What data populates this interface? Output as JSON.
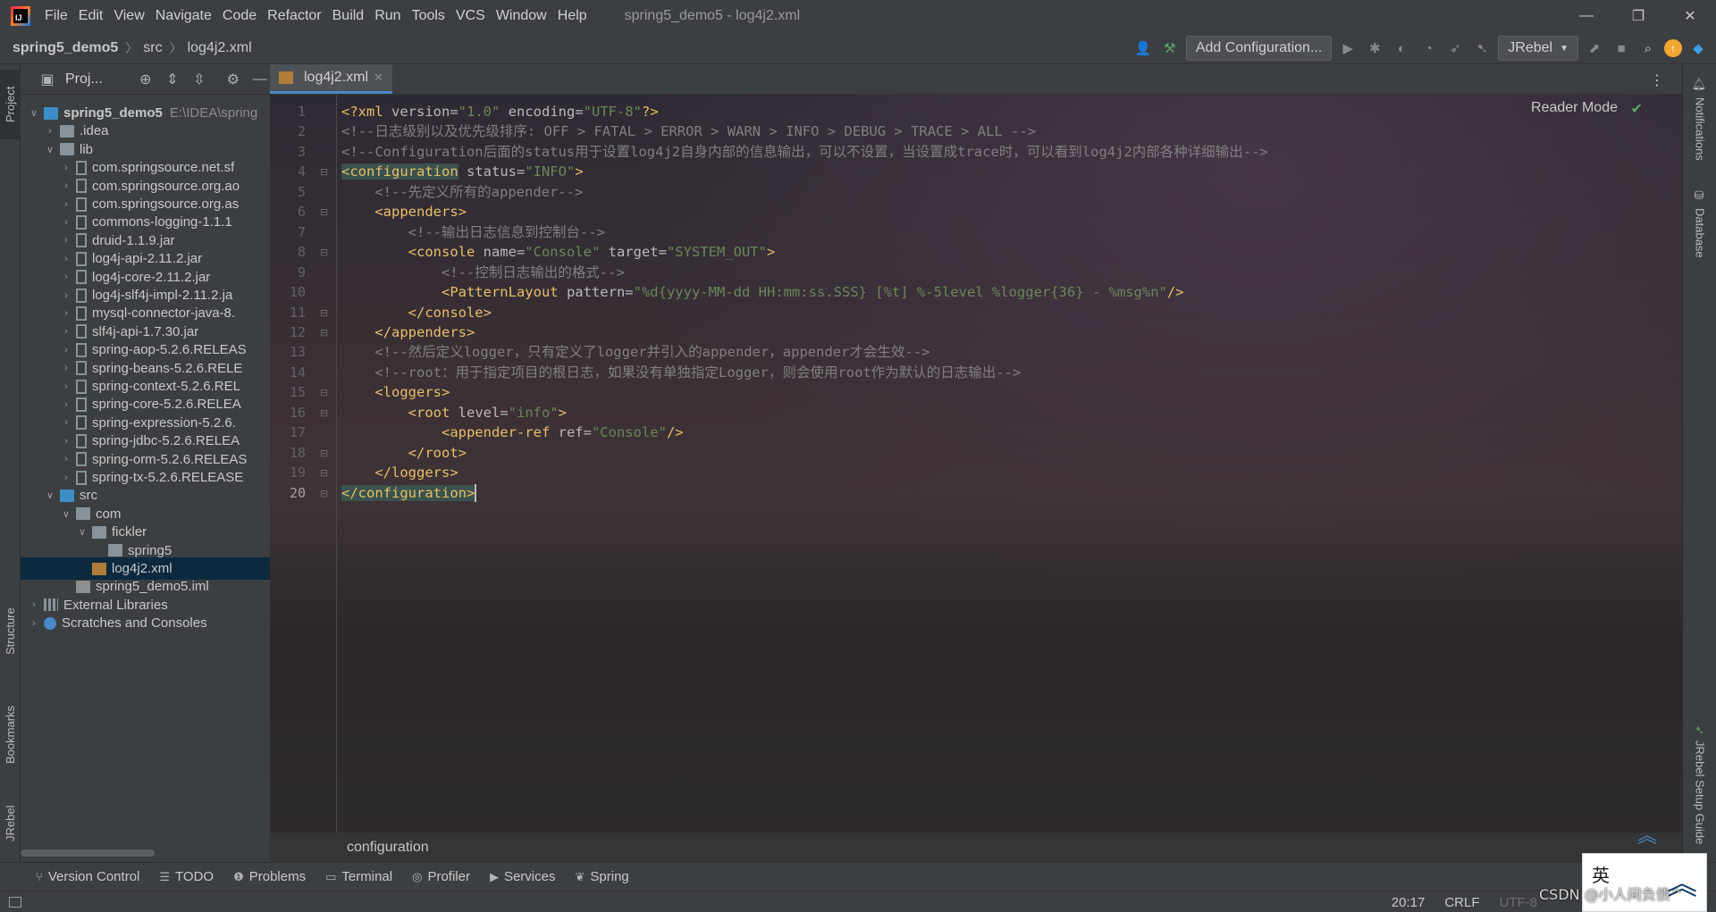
{
  "titlebar": {
    "menu": [
      "File",
      "Edit",
      "View",
      "Navigate",
      "Code",
      "Refactor",
      "Build",
      "Run",
      "Tools",
      "VCS",
      "Window",
      "Help"
    ],
    "window_title": "spring5_demo5 - log4j2.xml"
  },
  "navbar": {
    "breadcrumb": [
      "spring5_demo5",
      "src",
      "log4j2.xml"
    ],
    "add_configuration": "Add Configuration...",
    "jrebel_label": "JRebel"
  },
  "left_strip": {
    "project": "Project",
    "structure": "Structure",
    "bookmarks": "Bookmarks",
    "jrebel": "JRebel"
  },
  "project_panel": {
    "title": "Proj...",
    "tree": [
      {
        "label": "spring5_demo5",
        "path": "E:\\IDEA\\spring",
        "indent": 0,
        "arrow": "down",
        "icon": "module-folder",
        "bold": true
      },
      {
        "label": ".idea",
        "indent": 1,
        "arrow": "right",
        "icon": "folder"
      },
      {
        "label": "lib",
        "indent": 1,
        "arrow": "down",
        "icon": "folder"
      },
      {
        "label": "com.springsource.net.sf",
        "indent": 2,
        "arrow": "right",
        "icon": "jar"
      },
      {
        "label": "com.springsource.org.ao",
        "indent": 2,
        "arrow": "right",
        "icon": "jar"
      },
      {
        "label": "com.springsource.org.as",
        "indent": 2,
        "arrow": "right",
        "icon": "jar"
      },
      {
        "label": "commons-logging-1.1.1",
        "indent": 2,
        "arrow": "right",
        "icon": "jar"
      },
      {
        "label": "druid-1.1.9.jar",
        "indent": 2,
        "arrow": "right",
        "icon": "jar"
      },
      {
        "label": "log4j-api-2.11.2.jar",
        "indent": 2,
        "arrow": "right",
        "icon": "jar"
      },
      {
        "label": "log4j-core-2.11.2.jar",
        "indent": 2,
        "arrow": "right",
        "icon": "jar"
      },
      {
        "label": "log4j-slf4j-impl-2.11.2.ja",
        "indent": 2,
        "arrow": "right",
        "icon": "jar"
      },
      {
        "label": "mysql-connector-java-8.",
        "indent": 2,
        "arrow": "right",
        "icon": "jar"
      },
      {
        "label": "slf4j-api-1.7.30.jar",
        "indent": 2,
        "arrow": "right",
        "icon": "jar"
      },
      {
        "label": "spring-aop-5.2.6.RELEAS",
        "indent": 2,
        "arrow": "right",
        "icon": "jar"
      },
      {
        "label": "spring-beans-5.2.6.RELE",
        "indent": 2,
        "arrow": "right",
        "icon": "jar"
      },
      {
        "label": "spring-context-5.2.6.REL",
        "indent": 2,
        "arrow": "right",
        "icon": "jar"
      },
      {
        "label": "spring-core-5.2.6.RELEA",
        "indent": 2,
        "arrow": "right",
        "icon": "jar"
      },
      {
        "label": "spring-expression-5.2.6.",
        "indent": 2,
        "arrow": "right",
        "icon": "jar"
      },
      {
        "label": "spring-jdbc-5.2.6.RELEA",
        "indent": 2,
        "arrow": "right",
        "icon": "jar"
      },
      {
        "label": "spring-orm-5.2.6.RELEAS",
        "indent": 2,
        "arrow": "right",
        "icon": "jar"
      },
      {
        "label": "spring-tx-5.2.6.RELEASE",
        "indent": 2,
        "arrow": "right",
        "icon": "jar"
      },
      {
        "label": "src",
        "indent": 1,
        "arrow": "down",
        "icon": "source-folder"
      },
      {
        "label": "com",
        "indent": 2,
        "arrow": "down",
        "icon": "package"
      },
      {
        "label": "fickler",
        "indent": 3,
        "arrow": "down",
        "icon": "package"
      },
      {
        "label": "spring5",
        "indent": 4,
        "arrow": "none",
        "icon": "package"
      },
      {
        "label": "log4j2.xml",
        "indent": 3,
        "arrow": "none",
        "icon": "xml",
        "selected": true
      },
      {
        "label": "spring5_demo5.iml",
        "indent": 2,
        "arrow": "none",
        "icon": "iml"
      },
      {
        "label": "External Libraries",
        "indent": 0,
        "arrow": "right",
        "icon": "libraries"
      },
      {
        "label": "Scratches and Consoles",
        "indent": 0,
        "arrow": "right",
        "icon": "scratch"
      }
    ]
  },
  "editor": {
    "tab": "log4j2.xml",
    "reader_mode": "Reader Mode",
    "breadcrumb": "configuration",
    "current_line": 20,
    "lines": [
      [
        [
          "decl",
          "<?xml "
        ],
        [
          "attr",
          "version="
        ],
        [
          "val",
          "\"1.0\""
        ],
        [
          "attr",
          " encoding="
        ],
        [
          "val",
          "\"UTF-8\""
        ],
        [
          "decl",
          "?>"
        ]
      ],
      [
        [
          "comment",
          "<!--日志级别以及优先级排序: OFF > FATAL > ERROR > WARN > INFO > DEBUG > TRACE > ALL -->"
        ]
      ],
      [
        [
          "comment",
          "<!--Configuration后面的status用于设置log4j2自身内部的信息输出，可以不设置，当设置成trace时，可以看到log4j2内部各种详细输出-->"
        ]
      ],
      [
        [
          "taghl",
          "<configuration"
        ],
        [
          "attr",
          " status="
        ],
        [
          "val",
          "\"INFO\""
        ],
        [
          "tag",
          ">"
        ]
      ],
      [
        [
          "comment",
          "    <!--先定义所有的appender-->"
        ]
      ],
      [
        [
          "tag",
          "    <appenders"
        ],
        [
          "tag",
          ">"
        ]
      ],
      [
        [
          "comment",
          "        <!--输出日志信息到控制台-->"
        ]
      ],
      [
        [
          "tag",
          "        <console"
        ],
        [
          "attr",
          " name="
        ],
        [
          "val",
          "\"Console\""
        ],
        [
          "attr",
          " target="
        ],
        [
          "val",
          "\"SYSTEM_OUT\""
        ],
        [
          "tag",
          ">"
        ]
      ],
      [
        [
          "comment",
          "            <!--控制日志输出的格式-->"
        ]
      ],
      [
        [
          "tag",
          "            <PatternLayout"
        ],
        [
          "attr",
          " pattern="
        ],
        [
          "val",
          "\"%d{yyyy-MM-dd HH:mm:ss.SSS} [%t] %-5level %logger{36} - %msg%n\""
        ],
        [
          "tag",
          "/>"
        ]
      ],
      [
        [
          "tag",
          "        </console"
        ],
        [
          "tag",
          ">"
        ]
      ],
      [
        [
          "tag",
          "    </appenders"
        ],
        [
          "tag",
          ">"
        ]
      ],
      [
        [
          "comment",
          "    <!--然后定义logger，只有定义了logger并引入的appender，appender才会生效-->"
        ]
      ],
      [
        [
          "comment",
          "    <!--root：用于指定项目的根日志，如果没有单独指定Logger，则会使用root作为默认的日志输出-->"
        ]
      ],
      [
        [
          "tag",
          "    <loggers"
        ],
        [
          "tag",
          ">"
        ]
      ],
      [
        [
          "tag",
          "        <root"
        ],
        [
          "attr",
          " level="
        ],
        [
          "val",
          "\"info\""
        ],
        [
          "tag",
          ">"
        ]
      ],
      [
        [
          "tag",
          "            <appender-ref"
        ],
        [
          "attr",
          " ref="
        ],
        [
          "val",
          "\"Console\""
        ],
        [
          "tag",
          "/>"
        ]
      ],
      [
        [
          "tag",
          "        </root"
        ],
        [
          "tag",
          ">"
        ]
      ],
      [
        [
          "tag",
          "    </loggers"
        ],
        [
          "tag",
          ">"
        ]
      ],
      [
        [
          "taghl",
          "</configuration>"
        ]
      ]
    ]
  },
  "right_strip": {
    "notifications": "Notifications",
    "database": "Database",
    "jrebel_setup": "JRebel Setup Guide"
  },
  "bottom_tools": [
    {
      "label": "Version Control",
      "icon": "branch-icon"
    },
    {
      "label": "TODO",
      "icon": "list-icon"
    },
    {
      "label": "Problems",
      "icon": "warning-icon"
    },
    {
      "label": "Terminal",
      "icon": "terminal-icon"
    },
    {
      "label": "Profiler",
      "icon": "profiler-icon"
    },
    {
      "label": "Services",
      "icon": "play-icon"
    },
    {
      "label": "Spring",
      "icon": "spring-leaf-icon"
    }
  ],
  "statusbar": {
    "position": "20:17",
    "line_separator": "CRLF",
    "encoding": "UTF-8"
  },
  "overlay": {
    "ime": "英",
    "watermark": "CSDN @小人间负债^"
  }
}
